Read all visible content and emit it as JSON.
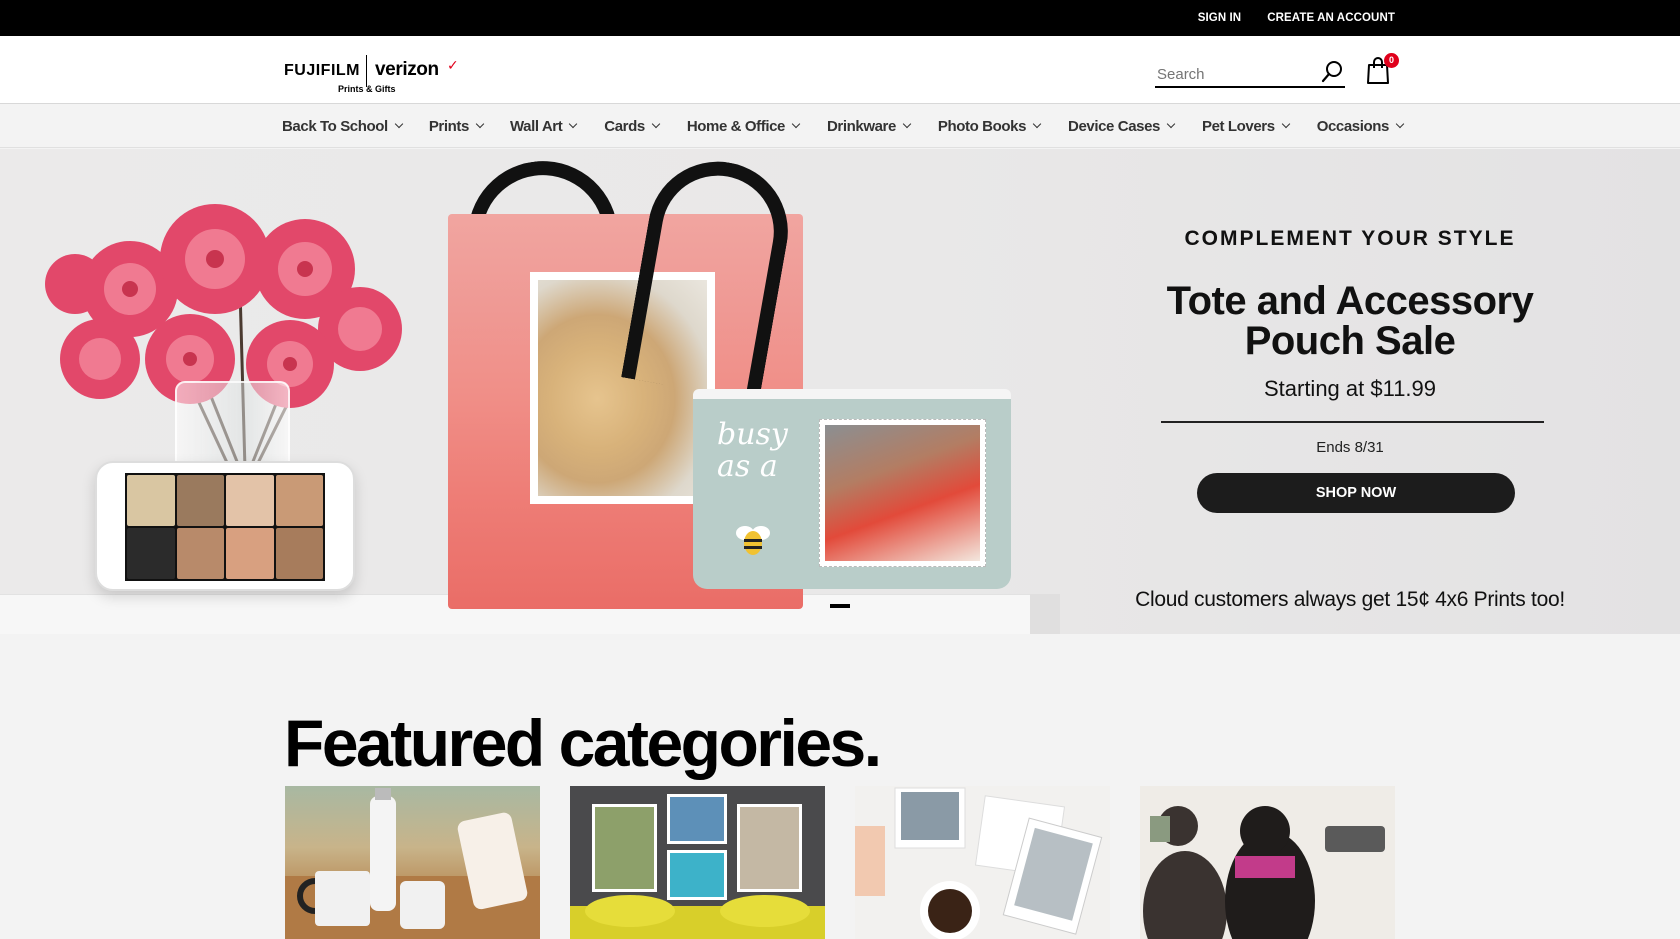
{
  "topbar": {
    "sign_in": "SIGN IN",
    "create_account": "CREATE AN ACCOUNT"
  },
  "header": {
    "logo_brand": "FUJIFILM",
    "logo_partner": "verizon",
    "logo_sub": "Prints & Gifts",
    "search_placeholder": "Search",
    "cart_count": "0",
    "colors": {
      "accent_red": "#e0001b",
      "text": "#000000"
    }
  },
  "nav": {
    "items": [
      {
        "label": "Back To School"
      },
      {
        "label": "Prints"
      },
      {
        "label": "Wall Art"
      },
      {
        "label": "Cards"
      },
      {
        "label": "Home & Office"
      },
      {
        "label": "Drinkware"
      },
      {
        "label": "Photo Books"
      },
      {
        "label": "Device Cases"
      },
      {
        "label": "Pet Lovers"
      },
      {
        "label": "Occasions"
      }
    ]
  },
  "hero": {
    "eyebrow": "COMPLEMENT YOUR STYLE",
    "title": "Tote and Accessory Pouch Sale",
    "price": "Starting at $11.99",
    "ends": "Ends 8/31",
    "cta": "SHOP NOW",
    "footnote": "Cloud customers always get 15¢ 4x6 Prints too!",
    "pouch_text": "busy as a"
  },
  "featured": {
    "title": "Featured categories."
  }
}
